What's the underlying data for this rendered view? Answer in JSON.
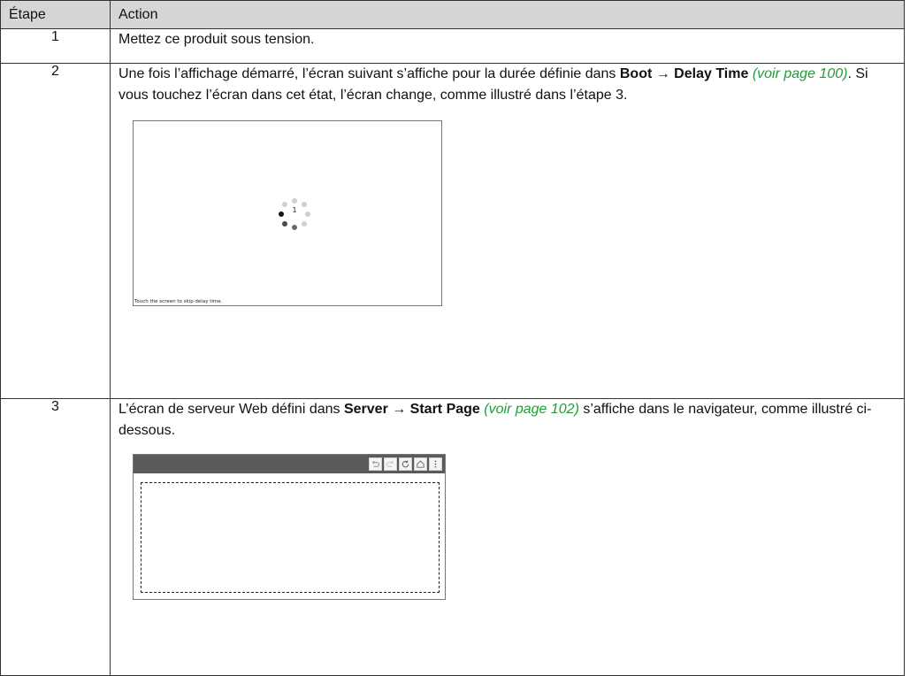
{
  "table": {
    "header": {
      "step": "Étape",
      "action": "Action"
    },
    "rows": [
      {
        "step": "1",
        "text": "Mettez ce produit sous tension."
      },
      {
        "step": "2",
        "t1": "Une fois l’affichage démarré, l’écran suivant s’affiche pour la durée définie dans ",
        "b1": "Boot → Delay Time",
        "link": "(voir page 100)",
        "t2": ". Si vous touchez l’écran dans cet état, l’écran change, comme illustré dans l’étape 3.",
        "boot_screen": {
          "countdown": "1",
          "caption": "Touch the screen to skip delay time."
        }
      },
      {
        "step": "3",
        "t1": "L’écran de serveur Web défini dans ",
        "b1": "Server → Start Page",
        "link": "(voir page 102)",
        "t2": " s’affiche dans le navigateur, comme illustré ci-dessous.",
        "browser": {
          "toolbar_icons": [
            "back-icon",
            "forward-icon",
            "refresh-icon",
            "home-icon",
            "menu-icon"
          ]
        }
      }
    ]
  },
  "colors": {
    "header_bg": "#d6d6d6",
    "link": "#1f9e36",
    "toolbar": "#5a5a5a"
  }
}
